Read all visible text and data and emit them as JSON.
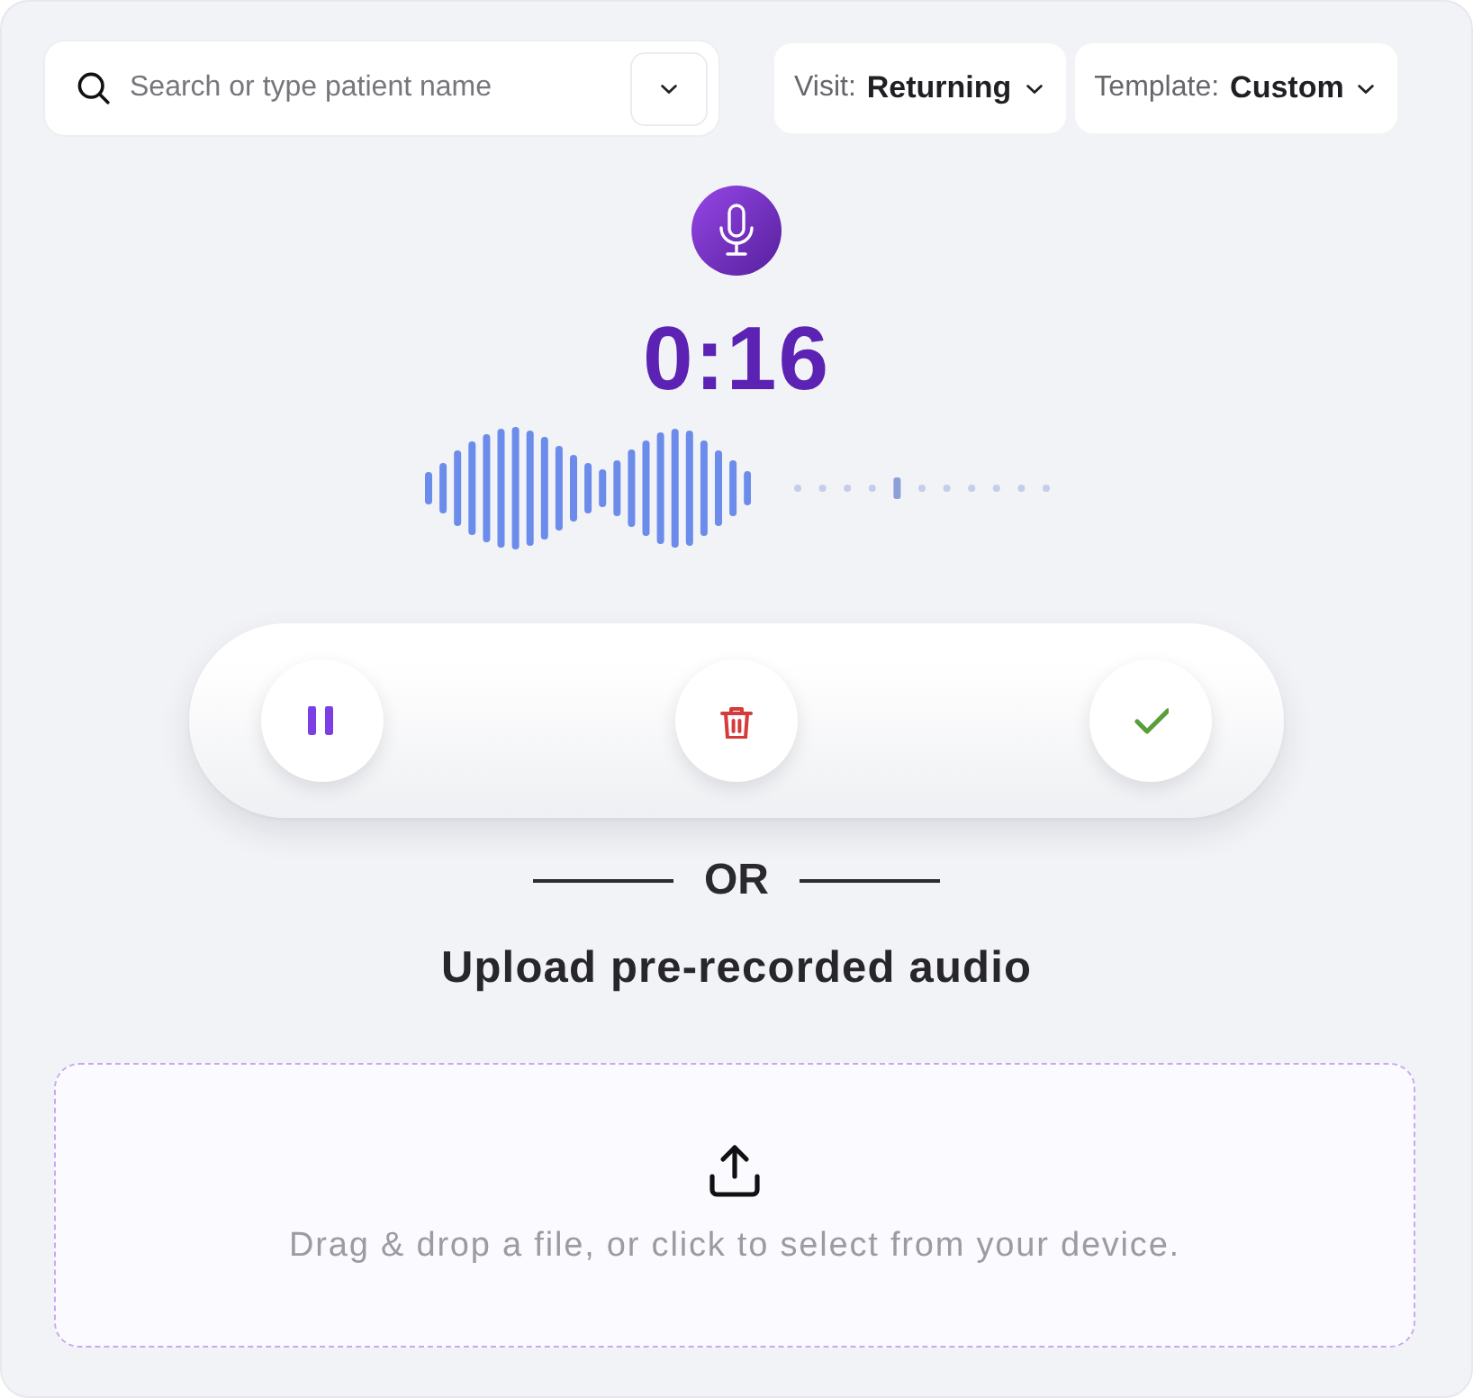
{
  "search": {
    "placeholder": "Search or type patient name"
  },
  "filters": [
    {
      "label": "Visit:",
      "value": "Returning"
    },
    {
      "label": "Template:",
      "value": "Custom"
    }
  ],
  "recorder": {
    "timer": "0:16",
    "controls": [
      {
        "kind": "pause"
      },
      {
        "kind": "delete"
      },
      {
        "kind": "confirm"
      }
    ]
  },
  "divider": {
    "label": "OR"
  },
  "upload": {
    "heading": "Upload pre-recorded audio",
    "hint": "Drag & drop a file, or click to select from your device."
  }
}
